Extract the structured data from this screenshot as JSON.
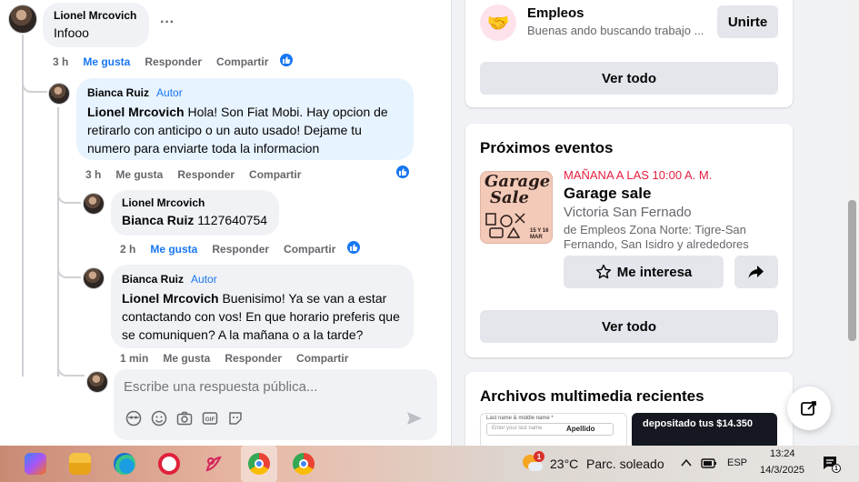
{
  "comments": {
    "top": {
      "author": "Lionel Mrcovich",
      "text": "Infooo",
      "time": "3 h",
      "like": "Me gusta",
      "reply": "Responder",
      "share": "Compartir"
    },
    "reply1": {
      "author": "Bianca Ruiz",
      "tag": "Autor",
      "mention": "Lionel Mrcovich",
      "text": " Hola! Son Fiat Mobi. Hay opcion de retirarlo con anticipo o un auto usado! Dejame tu numero para enviarte toda la informacion",
      "time": "3 h",
      "like": "Me gusta",
      "reply": "Responder",
      "share": "Compartir"
    },
    "reply2": {
      "author": "Lionel Mrcovich",
      "mention": "Bianca Ruiz",
      "text": " 1127640754",
      "time": "2 h",
      "like": "Me gusta",
      "reply": "Responder",
      "share": "Compartir"
    },
    "reply3": {
      "author": "Bianca Ruiz",
      "tag": "Autor",
      "mention": "Lionel Mrcovich",
      "text": " Buenisimo! Ya se van a estar contactando con vos! En que horario preferis que se comuniquen? A la mañana o a la tarde?",
      "time": "1 min",
      "like": "Me gusta",
      "reply": "Responder",
      "share": "Compartir"
    }
  },
  "more_icon": "···",
  "reply_box": {
    "placeholder": "Escribe una respuesta pública..."
  },
  "groups": {
    "name": "Empleos",
    "subtitle": "Buenas ando buscando trabajo ...",
    "join": "Unirte",
    "see_all": "Ver todo"
  },
  "events": {
    "title": "Próximos eventos",
    "date": "MAÑANA A LAS 10:00 A. M.",
    "name": "Garage sale",
    "location": "Victoria San Fernado",
    "group": "de Empleos Zona Norte: Tigre-San Fernando, San Isidro y alrededores",
    "interested": "Me interesa",
    "see_all": "Ver todo",
    "thumb_line1": "Garage",
    "thumb_line2": "Sale",
    "thumb_date": "15 Y 16 MAR",
    "accent": "#e41e3f"
  },
  "media": {
    "title": "Archivos multimedia recientes",
    "thumb1_field1": "Last name & middle name *",
    "thumb1_field2": "Apellido",
    "thumb1_field3": "Enter your last name",
    "thumb2_text": "depositado tus $14.350"
  },
  "taskbar": {
    "weather_temp": "23°C",
    "weather_text": "Parc. soleado",
    "weather_badge": "1",
    "language": "ESP",
    "time": "13:24",
    "date": "14/3/2025",
    "notif_count": "1"
  },
  "colors": {
    "fb_blue": "#1877f2",
    "event_red": "#e41e3f"
  }
}
